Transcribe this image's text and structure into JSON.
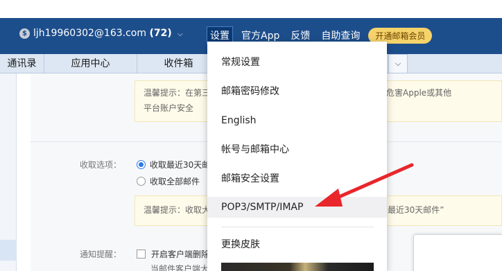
{
  "header": {
    "coin_symbol": "$",
    "account_email": "ljh19960302@163.com",
    "unread_count": "(72)",
    "nav": [
      {
        "label": "设置"
      },
      {
        "label": "官方App"
      },
      {
        "label": "反馈"
      },
      {
        "label": "自助查询"
      }
    ],
    "vip_label": "开通邮箱会员"
  },
  "tabs": [
    {
      "label": "通讯录"
    },
    {
      "label": "应用中心"
    },
    {
      "label": "收件箱"
    }
  ],
  "content": {
    "tip1_line1": "温馨提示：在第三",
    "tip1_right": "危害Apple或其他",
    "tip1_line2": "平台账户安全",
    "receive_label": "收取选项：",
    "opt_recent30": "收取最近30天邮",
    "opt_all": "收取全部邮件",
    "tip2_left": "温馨提示：收取大",
    "tip2_right": "最近30天邮件”",
    "notify_label": "通知提醒：",
    "notify_opt": "开启客户端删除",
    "notify_sub": "当邮件客户端大"
  },
  "menu": {
    "items": [
      {
        "label": "常规设置"
      },
      {
        "label": "邮箱密码修改"
      },
      {
        "label": "English"
      },
      {
        "label": "帐号与邮箱中心"
      },
      {
        "label": "邮箱安全设置"
      },
      {
        "label": "POP3/SMTP/IMAP"
      },
      {
        "label": "更换皮肤"
      }
    ]
  },
  "colors": {
    "header_bg": "#1d4e8c",
    "vip_bg": "#f6d36a",
    "arrow": "#e8262b",
    "radio_accent": "#2f7ae5"
  },
  "icons": {
    "coin": "coin-icon",
    "caret": "chevron-down-icon",
    "annotation": "red-arrow-icon"
  }
}
